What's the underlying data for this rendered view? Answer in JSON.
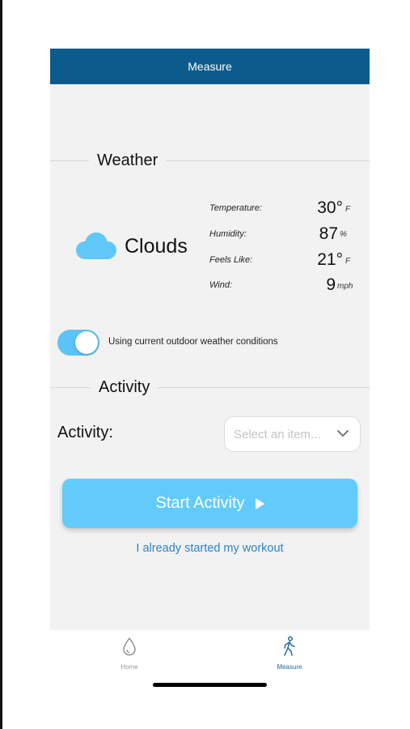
{
  "header": {
    "title": "Measure"
  },
  "weather": {
    "section_title": "Weather",
    "condition": "Clouds",
    "condition_icon": "cloud-icon",
    "metrics": [
      {
        "label": "Temperature:",
        "value": "30°",
        "unit": "F"
      },
      {
        "label": "Humidity:",
        "value": "87",
        "unit": "%"
      },
      {
        "label": "Feels Like:",
        "value": "21°",
        "unit": "F"
      },
      {
        "label": "Wind:",
        "value": "9",
        "unit": "mph"
      }
    ],
    "toggle": {
      "on": true,
      "label": "Using current outdoor weather conditions"
    }
  },
  "activity": {
    "section_title": "Activity",
    "field_label": "Activity:",
    "select_placeholder": "Select an item...",
    "start_button_label": "Start Activity",
    "already_started_link": "I already started my workout"
  },
  "tabs": [
    {
      "label": "Home",
      "icon": "water-drop-icon",
      "active": false
    },
    {
      "label": "Measure",
      "icon": "walking-person-icon",
      "active": true
    }
  ],
  "colors": {
    "header_bg": "#0d5b8c",
    "accent": "#62cbfc",
    "link": "#2d84c5",
    "active_tab": "#1f6b9c",
    "inactive_tab": "#999999"
  }
}
